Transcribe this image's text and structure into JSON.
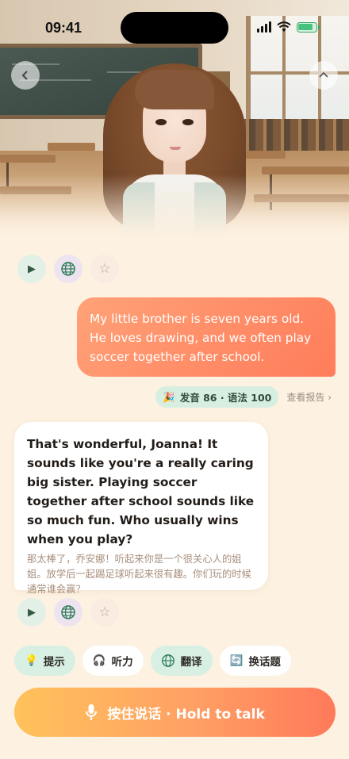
{
  "status_bar": {
    "time": "09:41"
  },
  "messages": {
    "user": "My little brother is seven years old. He loves drawing, and we often play soccer together after school.",
    "score": {
      "emoji": "🎉",
      "text": "发音 86 · 语法 100",
      "report_label": "查看报告 ›"
    },
    "ai": {
      "en": "That's wonderful, Joanna! It sounds like you're a really caring big sister. Playing soccer together after school sounds like so much fun. Who usually wins when you play?",
      "zh": "那太棒了，乔安娜！听起来你是一个很关心人的姐姐。放学后一起踢足球听起来很有趣。你们玩的时候通常谁会赢？"
    }
  },
  "controls": {
    "back_icon": "chevron-left",
    "collapse_icon": "chevron-up",
    "message_actions": [
      "play-icon",
      "globe-icon",
      "star-icon"
    ],
    "play_glyph": "▶",
    "star_glyph": "☆"
  },
  "chips": {
    "hint": {
      "icon": "💡",
      "label": "提示"
    },
    "listen": {
      "icon": "🎧",
      "label": "听力"
    },
    "translate": {
      "icon": "globe",
      "label": "翻译"
    },
    "topic": {
      "icon": "🔄",
      "label": "换话题"
    }
  },
  "talk_button": {
    "label": "按住说话 · Hold to talk"
  },
  "colors": {
    "background": "#fdf1e1",
    "user_bubble": "#ff8c66",
    "talk_gradient": [
      "#ffc25b",
      "#ff7a5a"
    ],
    "chip_green": "#d8f0e4"
  }
}
